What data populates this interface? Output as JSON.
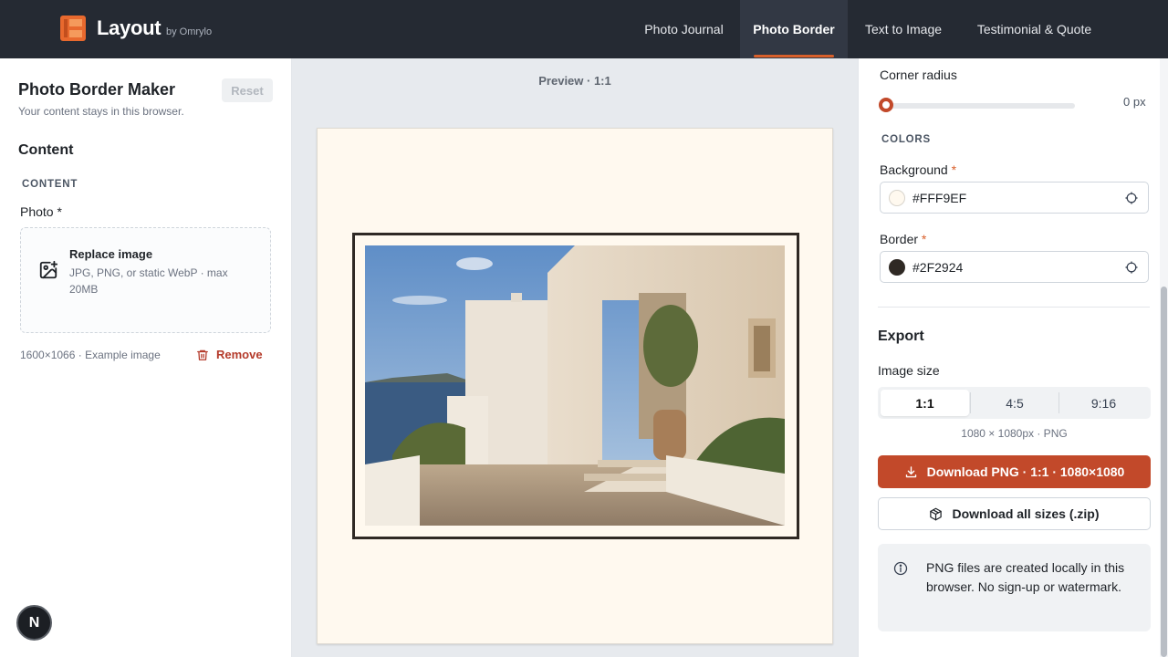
{
  "header": {
    "brand": "Layout",
    "brand_by": "by Omrylo",
    "nav": [
      {
        "label": "Photo Journal",
        "active": false
      },
      {
        "label": "Photo Border",
        "active": true
      },
      {
        "label": "Text to Image",
        "active": false
      },
      {
        "label": "Testimonial & Quote",
        "active": false
      }
    ],
    "accent_color": "#d9602b"
  },
  "left_panel": {
    "title": "Photo Border Maker",
    "subtitle": "Your content stays in this browser.",
    "reset_label": "Reset",
    "section_title": "Content",
    "section_label": "CONTENT",
    "photo_label": "Photo *",
    "dropzone": {
      "title": "Replace image",
      "hint": "JPG, PNG, or static WebP · max 20MB",
      "icon": "image-add-icon"
    },
    "image_meta": "1600×1066 · Example image",
    "remove_label": "Remove",
    "badge_letter": "N"
  },
  "preview": {
    "label": "Preview · 1:1",
    "background": "#FFF9EF",
    "border_color": "#2F2924"
  },
  "right_panel": {
    "corner_radius_label": "Corner radius",
    "corner_radius_value": "0 px",
    "corner_radius_level": 0,
    "colors_label": "COLORS",
    "background": {
      "label": "Background",
      "required_mark": "*",
      "value": "#FFF9EF"
    },
    "border": {
      "label": "Border",
      "required_mark": "*",
      "value": "#2F2924"
    },
    "export_title": "Export",
    "image_size_label": "Image size",
    "sizes": [
      {
        "label": "1:1",
        "active": true
      },
      {
        "label": "4:5",
        "active": false
      },
      {
        "label": "9:16",
        "active": false
      }
    ],
    "size_note": "1080 × 1080px · PNG",
    "download_label": "Download PNG · 1:1 · 1080×1080",
    "zip_label": "Download all sizes (.zip)",
    "info_text": "PNG files are created locally in this browser. No sign-up or watermark.",
    "download_color": "#c2492a"
  }
}
